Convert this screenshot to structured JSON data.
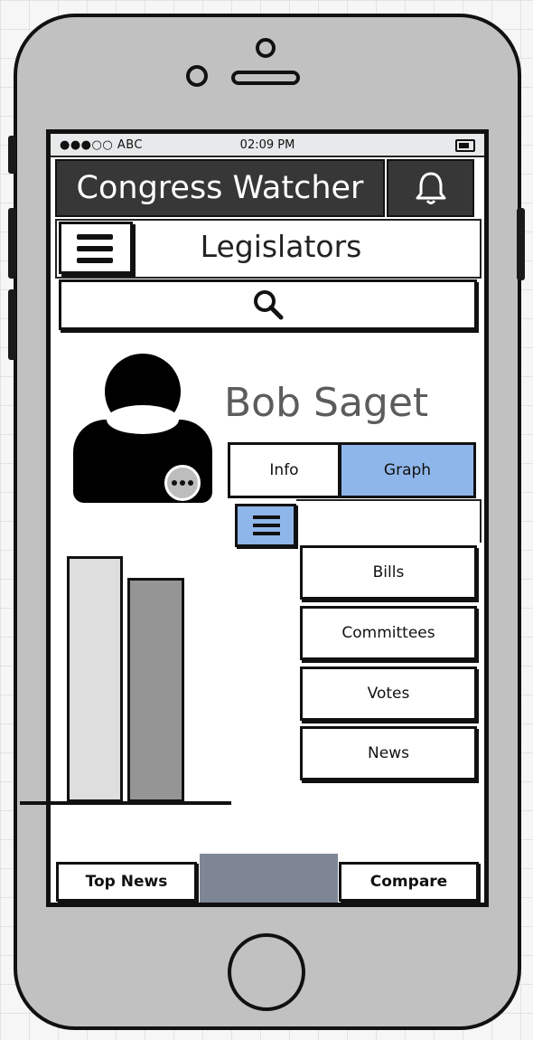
{
  "status_bar": {
    "carrier": "●●●○○ ABC",
    "time": "02:09 PM"
  },
  "header": {
    "title": "Congress Watcher",
    "bell_icon": "bell-icon"
  },
  "nav": {
    "title": "Legislators",
    "menu_icon": "hamburger-menu-icon"
  },
  "search": {
    "icon": "search-icon"
  },
  "profile": {
    "name": "Bob Saget",
    "avatar_icon": "person-avatar-icon",
    "more_icon": "more-dots-icon"
  },
  "tabs": [
    {
      "label": "Info",
      "active": false
    },
    {
      "label": "Graph",
      "active": true
    }
  ],
  "menu": {
    "icon": "hamburger-menu-icon",
    "items": [
      {
        "label": "Bills"
      },
      {
        "label": "Committees"
      },
      {
        "label": "Votes"
      },
      {
        "label": "News"
      }
    ]
  },
  "chart": {
    "bar_colors": [
      "#dedede",
      "#959595"
    ]
  },
  "bottom": {
    "left_label": "Top News",
    "right_label": "Compare"
  },
  "colors": {
    "header_bg": "#373737",
    "accent_blue": "#8fb6ea",
    "bottom_gray": "#7e8696",
    "phone_body": "#c1c1c1"
  }
}
